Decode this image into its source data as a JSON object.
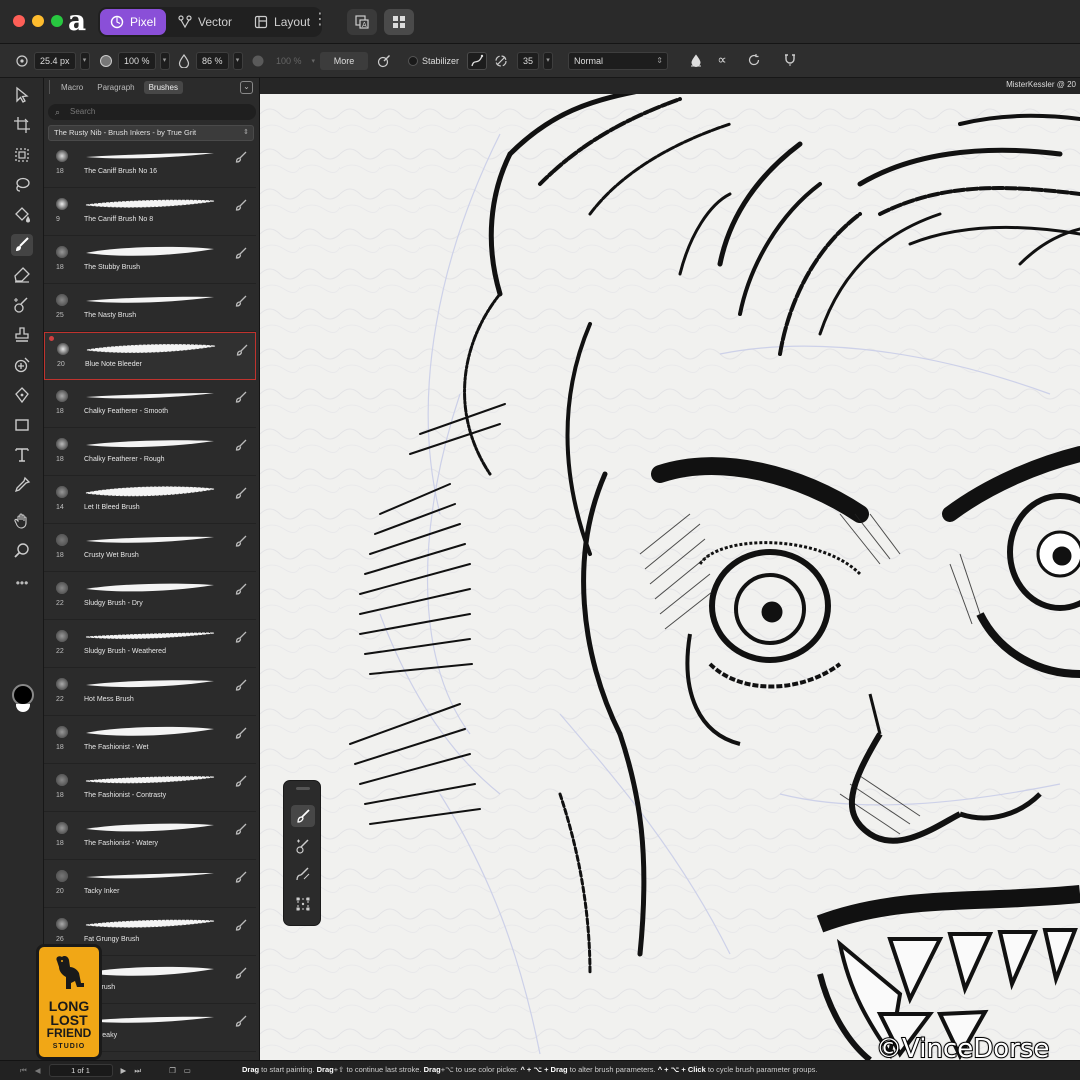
{
  "titlebar": {
    "personas": [
      {
        "label": "Pixel",
        "icon": "pixel-persona-icon",
        "active": true
      },
      {
        "label": "Vector",
        "icon": "vector-persona-icon",
        "active": false
      },
      {
        "label": "Layout",
        "icon": "layout-persona-icon",
        "active": false
      }
    ]
  },
  "context_toolbar": {
    "width": "25.4 px",
    "opacity": "100 %",
    "flow": "86 %",
    "hardness": "100 %",
    "more_label": "More",
    "stabilizer_label": "Stabilizer",
    "stabilizer_value": "35",
    "blend_mode": "Normal"
  },
  "brushes_panel": {
    "tabs": [
      {
        "label": "Macro",
        "active": false
      },
      {
        "label": "Paragraph",
        "active": false
      },
      {
        "label": "Brushes",
        "active": true
      }
    ],
    "search_placeholder": "Search",
    "category": "The Rusty Nib - Brush Inkers - by True Grit",
    "selected_index": 4,
    "brushes": [
      {
        "size": "18",
        "name": "The Caniff Brush No 16"
      },
      {
        "size": "9",
        "name": "The Caniff Brush No 8"
      },
      {
        "size": "18",
        "name": "The Stubby Brush"
      },
      {
        "size": "25",
        "name": "The Nasty Brush"
      },
      {
        "size": "20",
        "name": "Blue Note Bleeder"
      },
      {
        "size": "18",
        "name": "Chalky Featherer - Smooth"
      },
      {
        "size": "18",
        "name": "Chalky Featherer - Rough"
      },
      {
        "size": "14",
        "name": "Let It Bleed Brush"
      },
      {
        "size": "18",
        "name": "Crusty Wet Brush"
      },
      {
        "size": "22",
        "name": "Sludgy Brush - Dry"
      },
      {
        "size": "22",
        "name": "Sludgy Brush - Weathered"
      },
      {
        "size": "22",
        "name": "Hot Mess Brush"
      },
      {
        "size": "18",
        "name": "The Fashionist - Wet"
      },
      {
        "size": "18",
        "name": "The Fashionist - Contrasty"
      },
      {
        "size": "18",
        "name": "The Fashionist - Watery"
      },
      {
        "size": "20",
        "name": "Tacky Inker"
      },
      {
        "size": "26",
        "name": "Fat Grungy Brush"
      },
      {
        "size": "",
        "name": "kes Brush"
      },
      {
        "size": "",
        "name": "ith Streaky"
      }
    ]
  },
  "document": {
    "title": "MisterKessler @ 20"
  },
  "statusbar": {
    "page": "1 of 1",
    "hint_parts": [
      {
        "t": "Drag",
        "b": true
      },
      {
        "t": " to start painting. ",
        "b": false
      },
      {
        "t": "Drag",
        "b": true
      },
      {
        "t": "+⇧ to continue last stroke. ",
        "b": false
      },
      {
        "t": "Drag",
        "b": true
      },
      {
        "t": "+⌥ to use color picker. ",
        "b": false
      },
      {
        "t": "^ + ⌥ + Drag",
        "b": true
      },
      {
        "t": " to alter brush parameters. ",
        "b": false
      },
      {
        "t": "^ + ⌥ + Click",
        "b": true
      },
      {
        "t": " to cycle brush parameter groups.",
        "b": false
      }
    ]
  },
  "overlays": {
    "studio_logo_lines": [
      "LONG",
      "LOST",
      "FRIEND",
      "STUDIO"
    ],
    "watermark": "©VinceDorse"
  },
  "colors": {
    "accent": "#8a4fd8",
    "selection": "#c0332e",
    "canvas": "#f1f1ef",
    "logo": "#f1a716"
  }
}
